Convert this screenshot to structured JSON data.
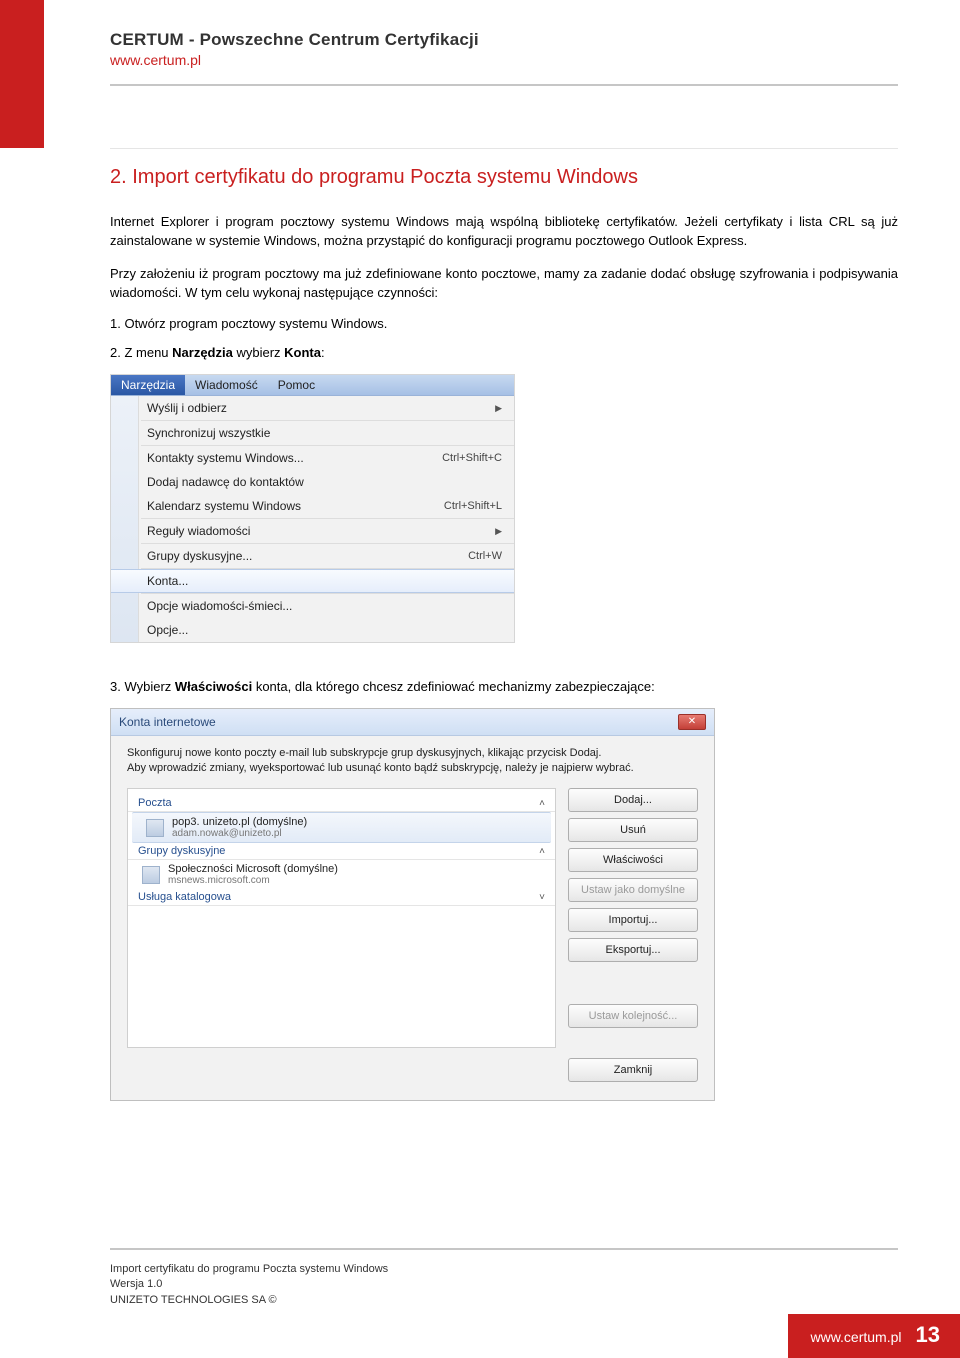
{
  "header": {
    "title": "CERTUM - Powszechne Centrum Certyfikacji",
    "url": "www.certum.pl"
  },
  "section": {
    "title": "2. Import certyfikatu do programu Poczta systemu Windows",
    "para1": "Internet Explorer i program pocztowy systemu Windows mają wspólną bibliotekę certyfikatów. Jeżeli certyfikaty i lista CRL są już zainstalowane w systemie Windows, można przystąpić do konfiguracji programu pocztowego Outlook Express.",
    "para2": "Przy założeniu iż program pocztowy ma już zdefiniowane konto pocztowe, mamy za zadanie dodać obsługę szyfrowania i podpisywania wiadomości. W tym celu wykonaj następujące czynności:",
    "step1": "1. Otwórz program pocztowy systemu Windows.",
    "step2_pre": "2. Z menu ",
    "step2_b1": "Narzędzia",
    "step2_mid": " wybierz ",
    "step2_b2": "Konta",
    "step2_post": ":",
    "step3_pre": "3. Wybierz ",
    "step3_b": "Właściwości",
    "step3_post": " konta, dla którego chcesz zdefiniować mechanizmy zabezpieczające:"
  },
  "menu": {
    "tabs": {
      "active": "Narzędzia",
      "t2": "Wiadomość",
      "t3": "Pomoc"
    },
    "items": {
      "send": "Wyślij i odbierz",
      "sync": "Synchronizuj wszystkie",
      "contacts": "Kontakty systemu Windows...",
      "contacts_sc": "Ctrl+Shift+C",
      "addSender": "Dodaj nadawcę do kontaktów",
      "calendar": "Kalendarz systemu Windows",
      "calendar_sc": "Ctrl+Shift+L",
      "rules": "Reguły wiadomości",
      "groups": "Grupy dyskusyjne...",
      "groups_sc": "Ctrl+W",
      "accounts": "Konta...",
      "junk": "Opcje wiadomości-śmieci...",
      "options": "Opcje..."
    }
  },
  "dialog": {
    "title": "Konta internetowe",
    "desc1": "Skonfiguruj nowe konto poczty e-mail lub subskrypcje grup dyskusyjnych, klikając przycisk Dodaj.",
    "desc2": "Aby wprowadzić zmiany, wyeksportować lub usunąć konto bądź subskrypcję, należy je najpierw wybrać.",
    "sections": {
      "mail": "Poczta",
      "news": "Grupy dyskusyjne",
      "dir": "Usługa katalogowa"
    },
    "mailAccount": {
      "name": "pop3. unizeto.pl (domyślne)",
      "email": "adam.nowak@unizeto.pl"
    },
    "newsAccount": {
      "name": "Społeczności Microsoft (domyślne)",
      "server": "msnews.microsoft.com"
    },
    "buttons": {
      "add": "Dodaj...",
      "remove": "Usuń",
      "props": "Właściwości",
      "default": "Ustaw jako domyślne",
      "import": "Importuj...",
      "export": "Eksportuj...",
      "order": "Ustaw kolejność...",
      "close": "Zamknij"
    }
  },
  "footer": {
    "line1": "Import certyfikatu do programu Poczta systemu Windows",
    "line2": "Wersja 1.0",
    "line3": "UNIZETO TECHNOLOGIES SA ©",
    "url": "www.certum.pl",
    "page": "13"
  }
}
